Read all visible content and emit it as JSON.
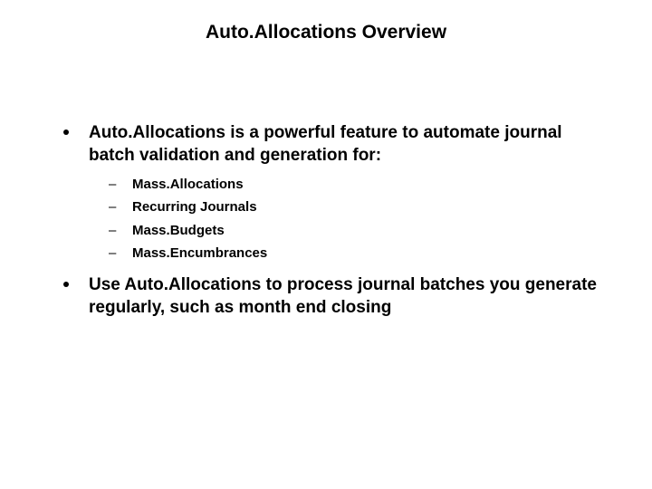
{
  "title": "Auto.Allocations Overview",
  "bullets": [
    {
      "text": "Auto.Allocations is a powerful feature to automate journal batch validation and generation for:",
      "subitems": [
        "Mass.Allocations",
        "Recurring Journals",
        "Mass.Budgets",
        "Mass.Encumbrances"
      ]
    },
    {
      "text": "Use Auto.Allocations to process journal batches you generate regularly, such as month end closing",
      "subitems": []
    }
  ]
}
